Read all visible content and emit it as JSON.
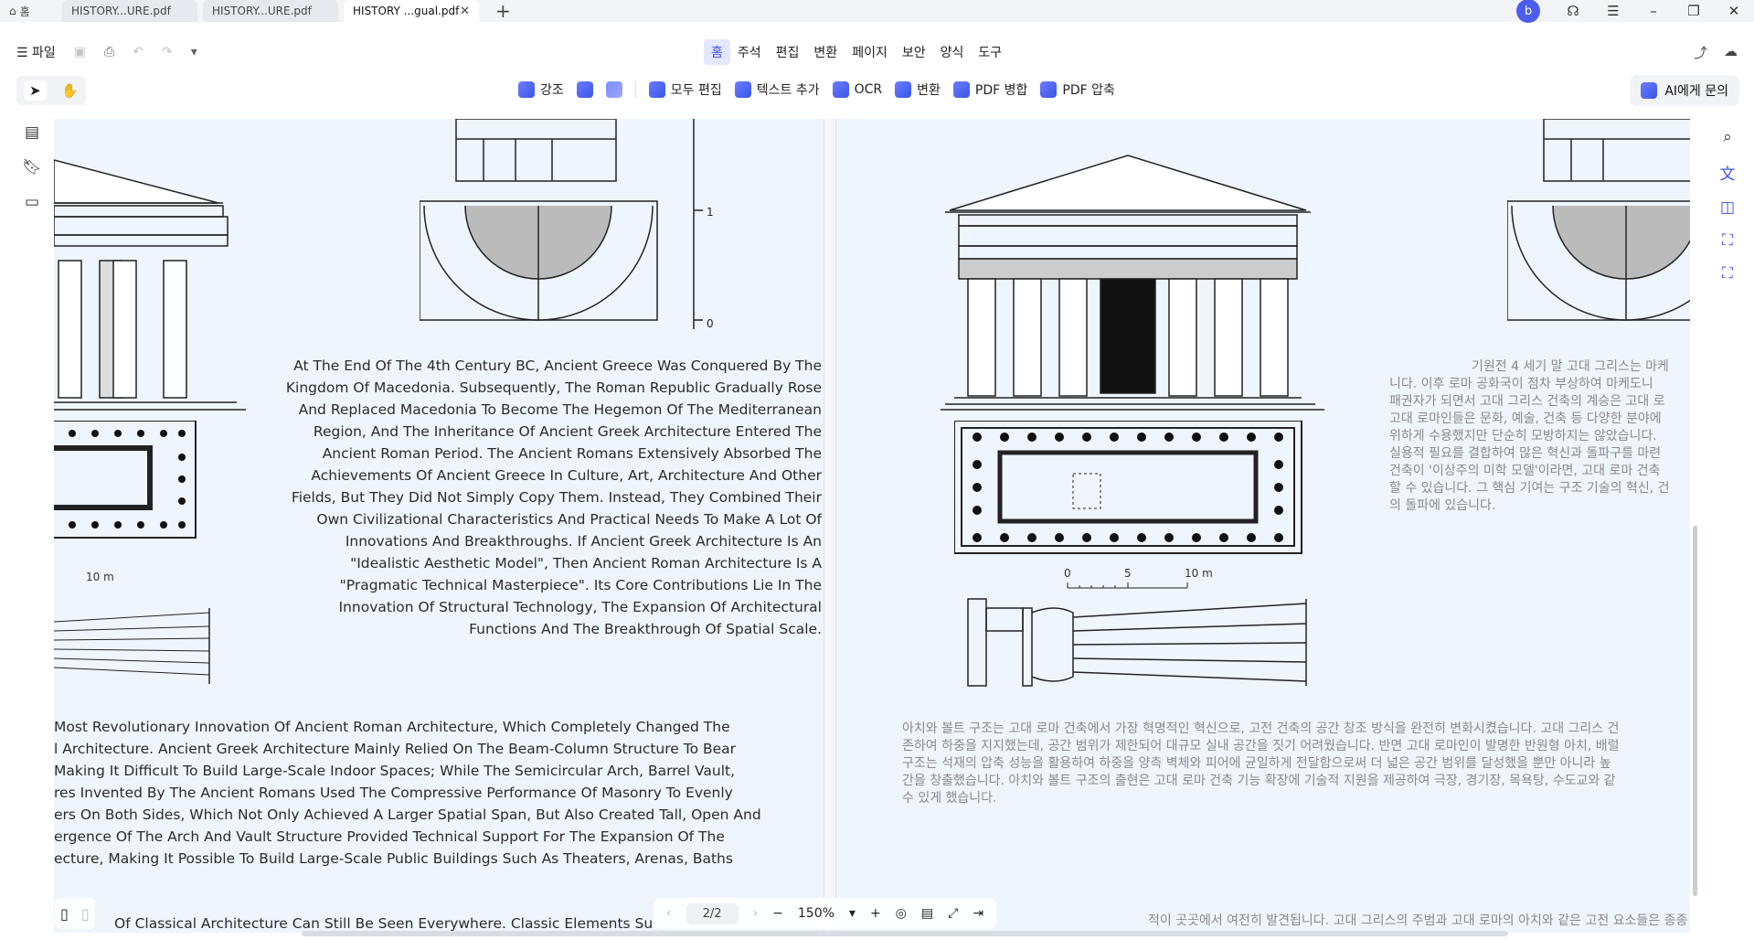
{
  "tabs": [
    {
      "label": "홈",
      "active": false
    },
    {
      "label": "HISTORY...URE.pdf",
      "active": false
    },
    {
      "label": "HISTORY...URE.pdf",
      "active": false
    },
    {
      "label": "HISTORY ...gual.pdf",
      "active": true
    }
  ],
  "user_initial": "b",
  "file_menu": "파일",
  "menus": [
    "홈",
    "주석",
    "편집",
    "변환",
    "페이지",
    "보안",
    "양식",
    "도구"
  ],
  "toolbar": {
    "highlight": "강조",
    "edit_all": "모두 편집",
    "add_text": "텍스트 추가",
    "ocr": "OCR",
    "convert": "변환",
    "pdf_merge": "PDF 병합",
    "pdf_compress": "PDF 압축",
    "ask_ai": "AI에게 문의"
  },
  "page_left": {
    "paragraph1": "At The End Of The 4th Century BC, Ancient Greece Was Conquered By The Kingdom Of Macedonia. Subsequently, The Roman Republic Gradually Rose And Replaced Macedonia To Become The Hegemon Of The Mediterranean Region, And The Inheritance Of Ancient Greek Architecture Entered The Ancient Roman Period. The Ancient Romans Extensively Absorbed The Achievements Of Ancient Greece In Culture, Art, Architecture And Other Fields, But They Did Not Simply Copy Them. Instead, They Combined Their Own Civilizational Characteristics And Practical Needs To Make A Lot Of Innovations And Breakthroughs. If Ancient Greek Architecture Is An \"Idealistic Aesthetic Model\", Then Ancient Roman Architecture Is A \"Pragmatic Technical Masterpiece\". Its Core Contributions Lie In The Innovation Of Structural Technology, The Expansion Of Architectural Functions And The Breakthrough Of Spatial Scale.",
    "paragraph2_lines": [
      " Most Revolutionary Innovation Of Ancient Roman Architecture, Which Completely Changed The",
      "l Architecture. Ancient Greek Architecture Mainly Relied On The Beam-Column Structure To Bear",
      "Making It Difficult To Build Large-Scale Indoor Spaces; While The Semicircular Arch, Barrel Vault,",
      "res Invented By The Ancient Romans Used The Compressive Performance Of Masonry To Evenly",
      "ers On Both Sides, Which Not Only Achieved A Larger Spatial Span, But Also Created Tall, Open And",
      "ergence Of The Arch And Vault Structure Provided Technical Support For The Expansion Of The",
      "ecture, Making It Possible To Build Large-Scale Public Buildings Such As Theaters, Arenas, Baths"
    ],
    "paragraph3": "Of Classical Architecture Can Still Be Seen Everywhere. Classic Elements Su",
    "scale_label": "10 m",
    "ruler_labels": [
      "1",
      "0"
    ]
  },
  "page_right": {
    "ko_paragraph1_lines": [
      "기원전 4 세기 말 고대 그리스는 마케",
      "니다. 이후 로마 공화국이 점차 부상하여 마케도니",
      "패권자가 되면서 고대 그리스 건축의 계승은 고대 로",
      "고대 로마인들은 문화, 예술, 건축 등 다양한 분야에",
      "위하게 수용했지만 단순히 모방하지는 않았습니다.",
      "실용적 필요를 결합하여 많은 혁신과 돌파구를 마련",
      "건축이 '이상주의 미학 모델'이라면, 고대 로마 건축",
      "할 수 있습니다. 그 핵심 기여는 구조 기술의 혁신, 건",
      "의 돌파에 있습니다."
    ],
    "ko_paragraph2_lines": [
      "아치와 볼트 구조는 고대 로마 건축에서 가장 혁명적인 혁신으로, 고전 건축의 공간 창조 방식을 완전히 변화시켰습니다. 고대 그리스 건",
      "존하여 하중을 지지했는데, 공간 범위가 제한되어 대규모 실내 공간을 짓기 어려웠습니다. 반면 고대 로마인이 발명한 반원형 아치, 배럴",
      "구조는 석재의 압축 성능을 활용하여 하중을 양측 벽체와 피어에 균일하게 전달함으로써 더 넓은 공간 범위를 달성했을 뿐만 아니라 높",
      "간을 창출했습니다. 아치와 볼트 구조의 출현은 고대 로마 건축 기능 확장에 기술적 지원을 제공하여 극장, 경기장, 목욕탕, 수도교와 같",
      "수 있게 했습니다."
    ],
    "ko_paragraph3": "적이 곳곳에서 여전히 발견됩니다. 고대 그리스의 주범과 고대 로마의 아치와 같은 고전 요소들은 종종",
    "scale_labels": [
      "0",
      "5",
      "10 m"
    ]
  },
  "pager": {
    "page": "2/2",
    "zoom": "150%"
  },
  "colors": {
    "accent": "#3b4ff0",
    "doc_bg": "#eef5fd",
    "menu_selected_bg": "#e3e7ff"
  }
}
